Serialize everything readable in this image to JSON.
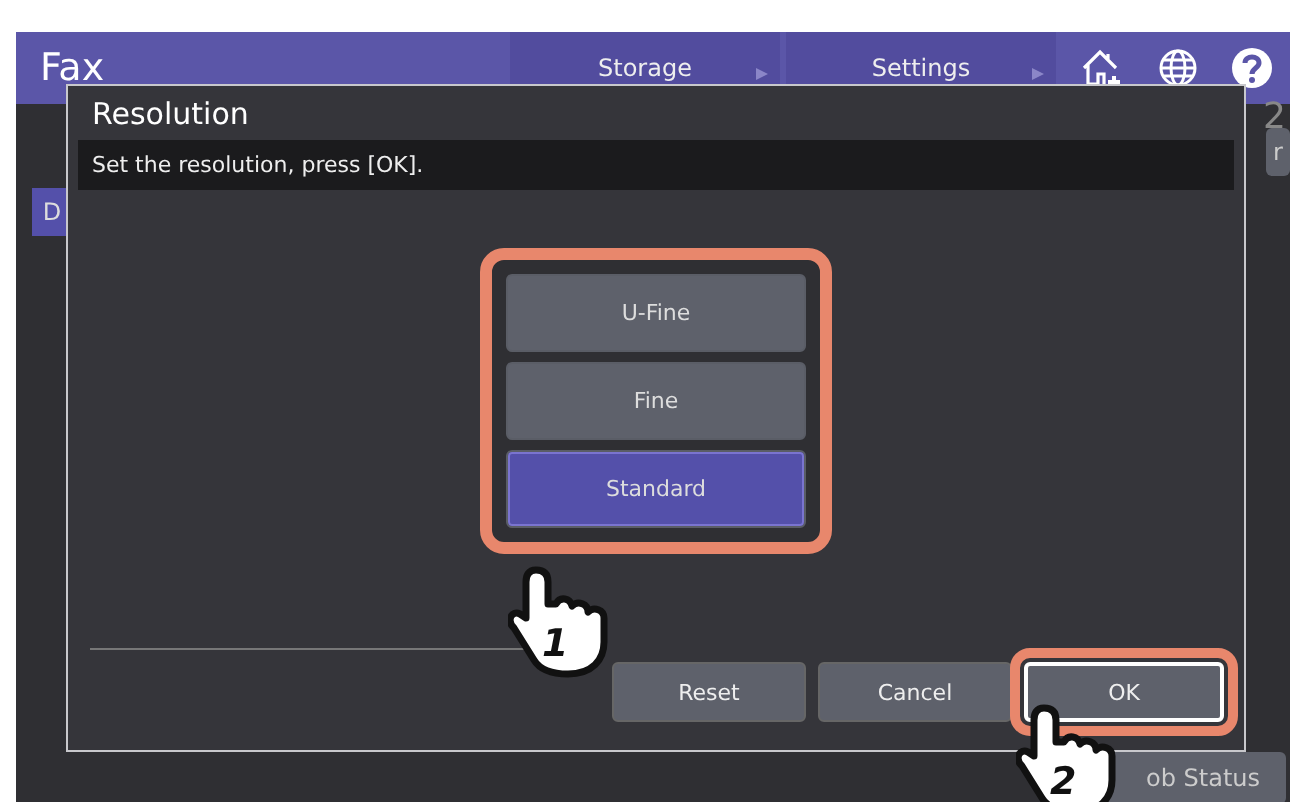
{
  "header": {
    "title": "Fax",
    "tabs": [
      {
        "label": "Storage"
      },
      {
        "label": "Settings"
      }
    ]
  },
  "background": {
    "counter": "2",
    "side_button": "r",
    "tab": "D",
    "status_button": "ob Status"
  },
  "dialog": {
    "title": "Resolution",
    "message": "Set the resolution, press [OK].",
    "options": [
      {
        "label": "U-Fine",
        "selected": false
      },
      {
        "label": "Fine",
        "selected": false
      },
      {
        "label": "Standard",
        "selected": true
      }
    ],
    "buttons": [
      {
        "label": "Reset",
        "highlighted": false
      },
      {
        "label": "Cancel",
        "highlighted": false
      },
      {
        "label": "OK",
        "highlighted": true
      }
    ]
  },
  "steps": [
    "1",
    "2"
  ]
}
